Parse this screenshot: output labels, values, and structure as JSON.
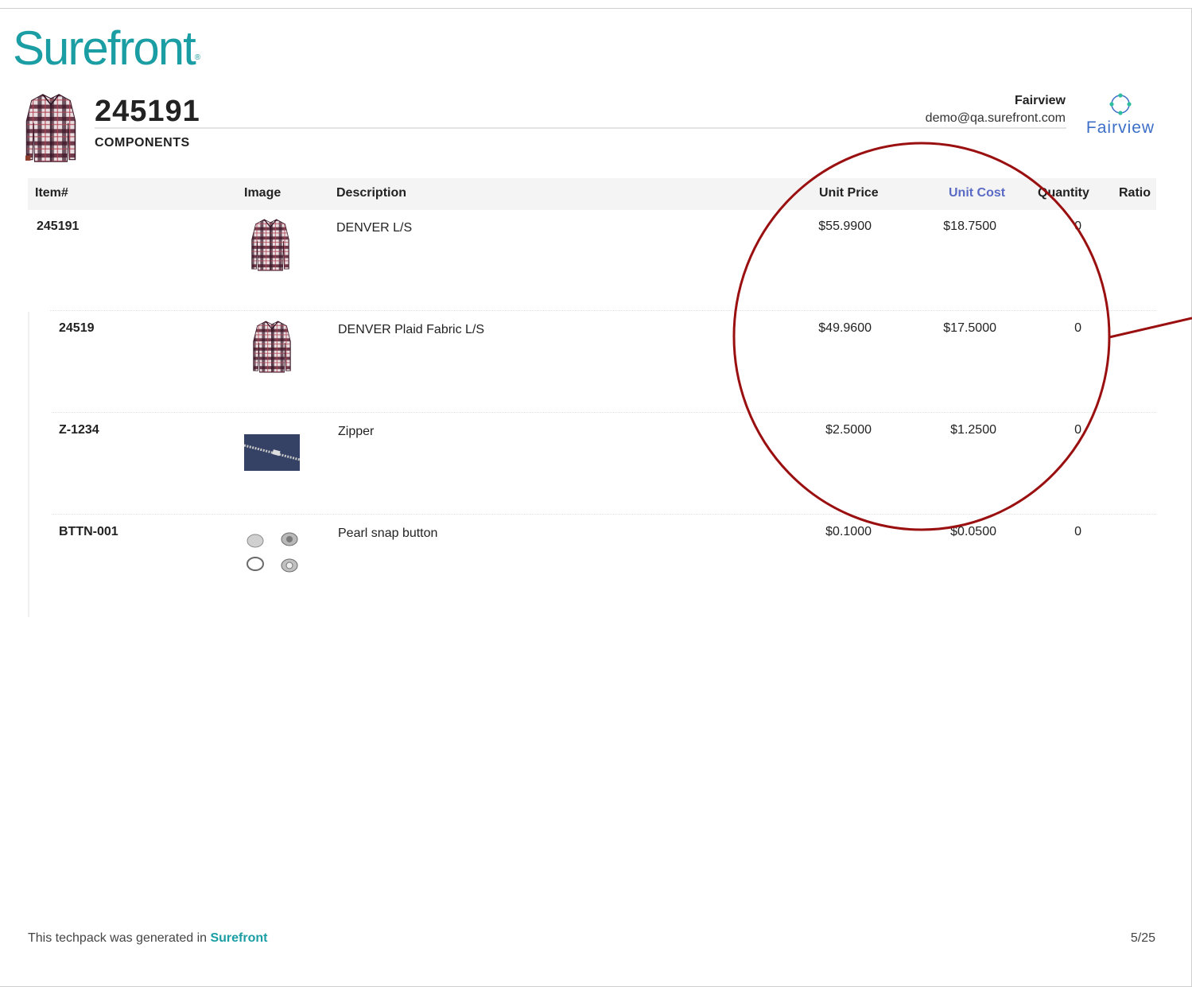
{
  "brand": {
    "name": "Surefront",
    "mark": "®"
  },
  "header": {
    "style_number": "245191",
    "section": "COMPONENTS",
    "company_name": "Fairview",
    "email": "demo@qa.surefront.com",
    "logo_text": "Fairview"
  },
  "table": {
    "columns": {
      "item": "Item#",
      "image": "Image",
      "description": "Description",
      "unit_price": "Unit Price",
      "unit_cost": "Unit Cost",
      "quantity": "Quantity",
      "ratio": "Ratio"
    },
    "rows": [
      {
        "item": "245191",
        "image": "shirt-image",
        "description": "DENVER L/S",
        "unit_price": "$55.9900",
        "unit_cost": "$18.7500",
        "quantity": "0",
        "ratio": ""
      },
      {
        "item": "24519",
        "image": "shirt-image",
        "description": "DENVER Plaid Fabric L/S",
        "unit_price": "$49.9600",
        "unit_cost": "$17.5000",
        "quantity": "0",
        "ratio": ""
      },
      {
        "item": "Z-1234",
        "image": "zipper-image",
        "description": "Zipper",
        "unit_price": "$2.5000",
        "unit_cost": "$1.2500",
        "quantity": "0",
        "ratio": ""
      },
      {
        "item": "BTTN-001",
        "image": "buttons-image",
        "description": "Pearl snap button",
        "unit_price": "$0.1000",
        "unit_cost": "$0.0500",
        "quantity": "0",
        "ratio": ""
      }
    ]
  },
  "footer": {
    "text": "This techpack was generated in",
    "brand": "Surefront",
    "page": "5/25"
  },
  "colors": {
    "brand": "#1a9ea3",
    "highlight_header": "#5b6ac4",
    "annotation": "#9a0f0f",
    "logo_blue": "#3d6fc7"
  }
}
